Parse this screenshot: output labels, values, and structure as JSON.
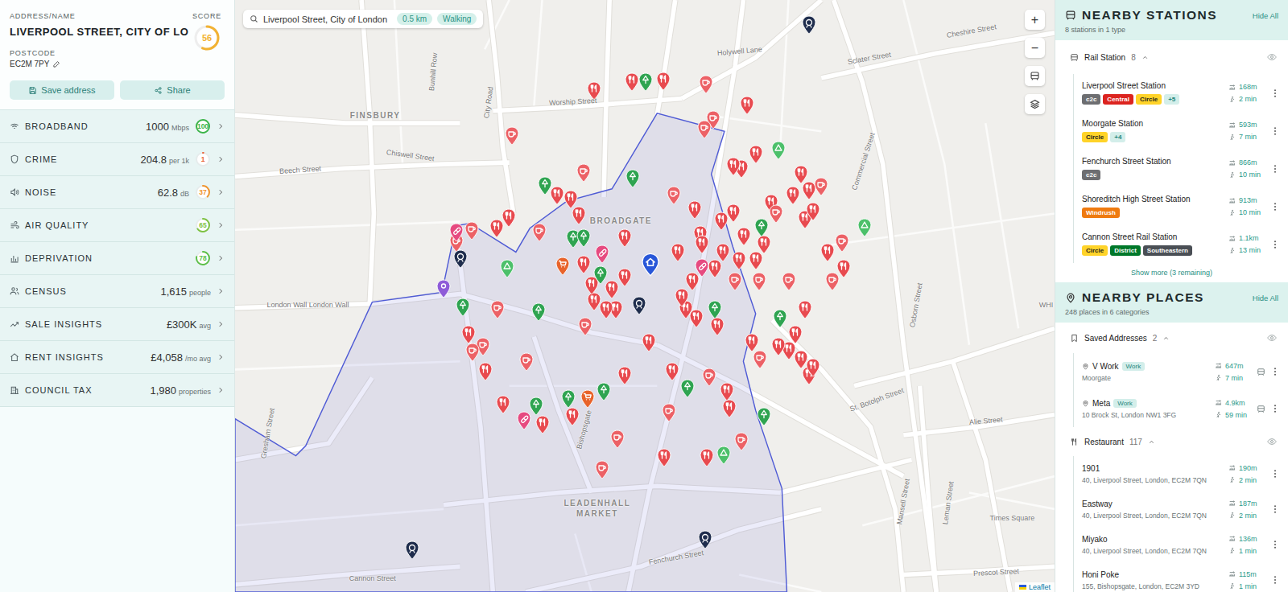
{
  "address": {
    "label": "ADDRESS/NAME",
    "name": "LIVERPOOL STREET, CITY OF LO",
    "score_label": "SCORE",
    "score": "56",
    "score_level": 0.56,
    "score_color": "#f2b233",
    "postcode_label": "POSTCODE",
    "postcode": "EC2M 7PY"
  },
  "actions": [
    {
      "label": "Save address"
    },
    {
      "label": "Share"
    }
  ],
  "metrics": [
    {
      "name": "BROADBAND",
      "kind": "scored",
      "value": "1000",
      "unit": "Mbps",
      "score": "100",
      "level": 1.0,
      "color": "#3cb54a"
    },
    {
      "name": "CRIME",
      "kind": "scored",
      "value": "204.8",
      "unit": "per 1k",
      "score": "1",
      "level": 0.01,
      "color": "#e8643a"
    },
    {
      "name": "NOISE",
      "kind": "scored",
      "value": "62.8",
      "unit": "dB",
      "score": "37",
      "level": 0.37,
      "color": "#f0952e"
    },
    {
      "name": "AIR QUALITY",
      "kind": "score-only",
      "score": "65",
      "level": 0.65,
      "color": "#7dc242"
    },
    {
      "name": "DEPRIVATION",
      "kind": "score-only",
      "score": "78",
      "level": 0.78,
      "color": "#5cbf48"
    },
    {
      "name": "CENSUS",
      "kind": "value",
      "value": "1,615",
      "unit": "people"
    },
    {
      "name": "SALE INSIGHTS",
      "kind": "value",
      "value": "£300K",
      "unit": "avg"
    },
    {
      "name": "RENT INSIGHTS",
      "kind": "value",
      "value": "£4,058",
      "unit": "/mo avg"
    },
    {
      "name": "COUNCIL TAX",
      "kind": "value",
      "value": "1,980",
      "unit": "properties"
    }
  ],
  "map": {
    "search": {
      "value": "Liverpool Street, City of London",
      "chips": [
        "0.5 km",
        "Walking"
      ]
    },
    "zoom_in": "+",
    "zoom_out": "−",
    "attribution": "Leaflet",
    "labels": [
      {
        "text": "FINSBURY",
        "kind": "area"
      },
      {
        "text": "BROADGATE",
        "kind": "area"
      },
      {
        "text": "LEADENHALL MARKET",
        "kind": "area"
      },
      {
        "text": "City Road",
        "kind": "street"
      },
      {
        "text": "Worship Street",
        "kind": "street"
      },
      {
        "text": "Holywell Lane",
        "kind": "street"
      },
      {
        "text": "Sclater Street",
        "kind": "street"
      },
      {
        "text": "Cheshire Street",
        "kind": "street"
      },
      {
        "text": "Chiswell Street",
        "kind": "street"
      },
      {
        "text": "Beech Street",
        "kind": "street"
      },
      {
        "text": "Bunhill Row",
        "kind": "street"
      },
      {
        "text": "London Wall London Wall",
        "kind": "street"
      },
      {
        "text": "Commercial Street",
        "kind": "street"
      },
      {
        "text": "Bishopsgate",
        "kind": "street"
      },
      {
        "text": "Fenchurch Street",
        "kind": "street"
      },
      {
        "text": "Cannon Street",
        "kind": "street"
      },
      {
        "text": "St. Botolph Street",
        "kind": "street"
      },
      {
        "text": "WHI",
        "kind": "street"
      },
      {
        "text": "Alie Street",
        "kind": "street"
      },
      {
        "text": "Leman Street",
        "kind": "street"
      },
      {
        "text": "Mansell Street",
        "kind": "street"
      },
      {
        "text": "Prescot Street",
        "kind": "street"
      },
      {
        "text": "Times Square",
        "kind": "street"
      },
      {
        "text": "Osborn Street",
        "kind": "street"
      },
      {
        "text": "Gresham Street",
        "kind": "street"
      }
    ],
    "marker_types": [
      {
        "kind": "food",
        "color": "#e84a4f"
      },
      {
        "kind": "cafe",
        "color": "#ec6166"
      },
      {
        "kind": "park",
        "color": "#2fa451"
      },
      {
        "kind": "sport",
        "color": "#4cc06a"
      },
      {
        "kind": "shop",
        "color": "#e8632a"
      },
      {
        "kind": "pharmacy",
        "color": "#e64a80"
      },
      {
        "kind": "station",
        "color": "#1f2d4d"
      },
      {
        "kind": "saved",
        "color": "#8e5bd8"
      },
      {
        "kind": "home",
        "color": "#2856d8"
      }
    ],
    "markers": [
      {
        "kind": "food"
      },
      {
        "kind": "food"
      },
      {
        "kind": "food"
      },
      {
        "kind": "food"
      },
      {
        "kind": "food"
      },
      {
        "kind": "food"
      },
      {
        "kind": "food"
      },
      {
        "kind": "food"
      },
      {
        "kind": "food"
      },
      {
        "kind": "food"
      },
      {
        "kind": "food"
      },
      {
        "kind": "food"
      },
      {
        "kind": "food"
      },
      {
        "kind": "food"
      },
      {
        "kind": "food"
      },
      {
        "kind": "food"
      },
      {
        "kind": "food"
      },
      {
        "kind": "food"
      },
      {
        "kind": "food"
      },
      {
        "kind": "food"
      },
      {
        "kind": "food"
      },
      {
        "kind": "food"
      },
      {
        "kind": "food"
      },
      {
        "kind": "food"
      },
      {
        "kind": "food"
      },
      {
        "kind": "food"
      },
      {
        "kind": "food"
      },
      {
        "kind": "food"
      },
      {
        "kind": "food"
      },
      {
        "kind": "food"
      },
      {
        "kind": "food"
      },
      {
        "kind": "food"
      },
      {
        "kind": "food"
      },
      {
        "kind": "food"
      },
      {
        "kind": "food"
      },
      {
        "kind": "food"
      },
      {
        "kind": "food"
      },
      {
        "kind": "food"
      },
      {
        "kind": "food"
      },
      {
        "kind": "food"
      },
      {
        "kind": "food"
      },
      {
        "kind": "food"
      },
      {
        "kind": "food"
      },
      {
        "kind": "food"
      },
      {
        "kind": "food"
      },
      {
        "kind": "food"
      },
      {
        "kind": "food"
      },
      {
        "kind": "food"
      },
      {
        "kind": "food"
      },
      {
        "kind": "food"
      },
      {
        "kind": "food"
      },
      {
        "kind": "food"
      },
      {
        "kind": "food"
      },
      {
        "kind": "food"
      },
      {
        "kind": "food"
      },
      {
        "kind": "food"
      },
      {
        "kind": "food"
      },
      {
        "kind": "food"
      },
      {
        "kind": "food"
      },
      {
        "kind": "food"
      },
      {
        "kind": "food"
      },
      {
        "kind": "food"
      },
      {
        "kind": "food"
      },
      {
        "kind": "food"
      },
      {
        "kind": "food"
      },
      {
        "kind": "cafe"
      },
      {
        "kind": "cafe"
      },
      {
        "kind": "cafe"
      },
      {
        "kind": "cafe"
      },
      {
        "kind": "cafe"
      },
      {
        "kind": "cafe"
      },
      {
        "kind": "cafe"
      },
      {
        "kind": "cafe"
      },
      {
        "kind": "cafe"
      },
      {
        "kind": "cafe"
      },
      {
        "kind": "cafe"
      },
      {
        "kind": "cafe"
      },
      {
        "kind": "cafe"
      },
      {
        "kind": "cafe"
      },
      {
        "kind": "cafe"
      },
      {
        "kind": "cafe"
      },
      {
        "kind": "cafe"
      },
      {
        "kind": "cafe"
      },
      {
        "kind": "cafe"
      },
      {
        "kind": "cafe"
      },
      {
        "kind": "cafe"
      },
      {
        "kind": "cafe"
      },
      {
        "kind": "cafe"
      },
      {
        "kind": "cafe"
      },
      {
        "kind": "cafe"
      },
      {
        "kind": "cafe"
      },
      {
        "kind": "cafe"
      },
      {
        "kind": "park"
      },
      {
        "kind": "park"
      },
      {
        "kind": "park"
      },
      {
        "kind": "park"
      },
      {
        "kind": "park"
      },
      {
        "kind": "park"
      },
      {
        "kind": "park"
      },
      {
        "kind": "park"
      },
      {
        "kind": "park"
      },
      {
        "kind": "park"
      },
      {
        "kind": "park"
      },
      {
        "kind": "park"
      },
      {
        "kind": "park"
      },
      {
        "kind": "park"
      },
      {
        "kind": "park"
      },
      {
        "kind": "park"
      },
      {
        "kind": "sport"
      },
      {
        "kind": "sport"
      },
      {
        "kind": "sport"
      },
      {
        "kind": "sport"
      },
      {
        "kind": "shop"
      },
      {
        "kind": "shop"
      },
      {
        "kind": "pharmacy"
      },
      {
        "kind": "pharmacy"
      },
      {
        "kind": "pharmacy"
      },
      {
        "kind": "pharmacy"
      },
      {
        "kind": "station"
      },
      {
        "kind": "station"
      },
      {
        "kind": "station"
      },
      {
        "kind": "station"
      },
      {
        "kind": "station"
      },
      {
        "kind": "saved"
      },
      {
        "kind": "home"
      }
    ]
  },
  "stations": {
    "title": "NEARBY STATIONS",
    "hide": "Hide All",
    "summary": "8 stations in 1 type",
    "group": {
      "name": "Rail Station",
      "count": "8",
      "expanded": true,
      "visible": true
    },
    "items": [
      {
        "name": "Liverpool Street Station",
        "tags": [
          {
            "text": "c2c",
            "color": "#6d6e71"
          },
          {
            "text": "Central",
            "color": "#dc241f"
          },
          {
            "text": "Circle",
            "color": "#ffd329"
          },
          {
            "text": "+5",
            "color": "#d3eeea"
          }
        ],
        "distance": "168m",
        "time": "2 min"
      },
      {
        "name": "Moorgate Station",
        "tags": [
          {
            "text": "Circle",
            "color": "#ffd329"
          },
          {
            "text": "+4",
            "color": "#d3eeea"
          }
        ],
        "distance": "593m",
        "time": "7 min"
      },
      {
        "name": "Fenchurch Street Station",
        "tags": [
          {
            "text": "c2c",
            "color": "#6d6e71"
          }
        ],
        "distance": "866m",
        "time": "10 min"
      },
      {
        "name": "Shoreditch High Street Station",
        "tags": [
          {
            "text": "Windrush",
            "color": "#ef7b10"
          }
        ],
        "distance": "913m",
        "time": "10 min"
      },
      {
        "name": "Cannon Street Rail Station",
        "tags": [
          {
            "text": "Circle",
            "color": "#ffd329"
          },
          {
            "text": "District",
            "color": "#00782a"
          },
          {
            "text": "Southeastern",
            "color": "#4a4f55"
          }
        ],
        "distance": "1.1km",
        "time": "13 min"
      }
    ],
    "more": "Show more (3 remaining)"
  },
  "places": {
    "title": "NEARBY PLACES",
    "hide": "Hide All",
    "summary": "248 places in 6 categories",
    "groups": [
      {
        "name": "Saved Addresses",
        "kind": "saved",
        "count": "2",
        "expanded": true,
        "visible": true,
        "items": [
          {
            "name": "V Work",
            "badge": "Work",
            "address": "Moorgate",
            "distance": "647m",
            "time": "7 min"
          },
          {
            "name": "Meta",
            "badge": "Work",
            "address": "10 Brock St, London NW1 3FG",
            "distance": "4.9km",
            "time": "59 min"
          }
        ]
      },
      {
        "name": "Restaurant",
        "kind": "restaurant",
        "count": "117",
        "expanded": true,
        "visible": true,
        "items": [
          {
            "name": "1901",
            "badge": "",
            "address": "40, Liverpool Street, London, EC2M 7QN",
            "distance": "190m",
            "time": "2 min"
          },
          {
            "name": "Eastway",
            "badge": "",
            "address": "40, Liverpool Street, London, EC2M 7QN",
            "distance": "187m",
            "time": "2 min"
          },
          {
            "name": "Miyako",
            "badge": "",
            "address": "40, Liverpool Street, London, EC2M 7QN",
            "distance": "136m",
            "time": "1 min"
          },
          {
            "name": "Honi Poke",
            "badge": "",
            "address": "155, Bishopsgate, London, EC2M 3YD",
            "distance": "115m",
            "time": "1 min"
          }
        ]
      }
    ]
  }
}
